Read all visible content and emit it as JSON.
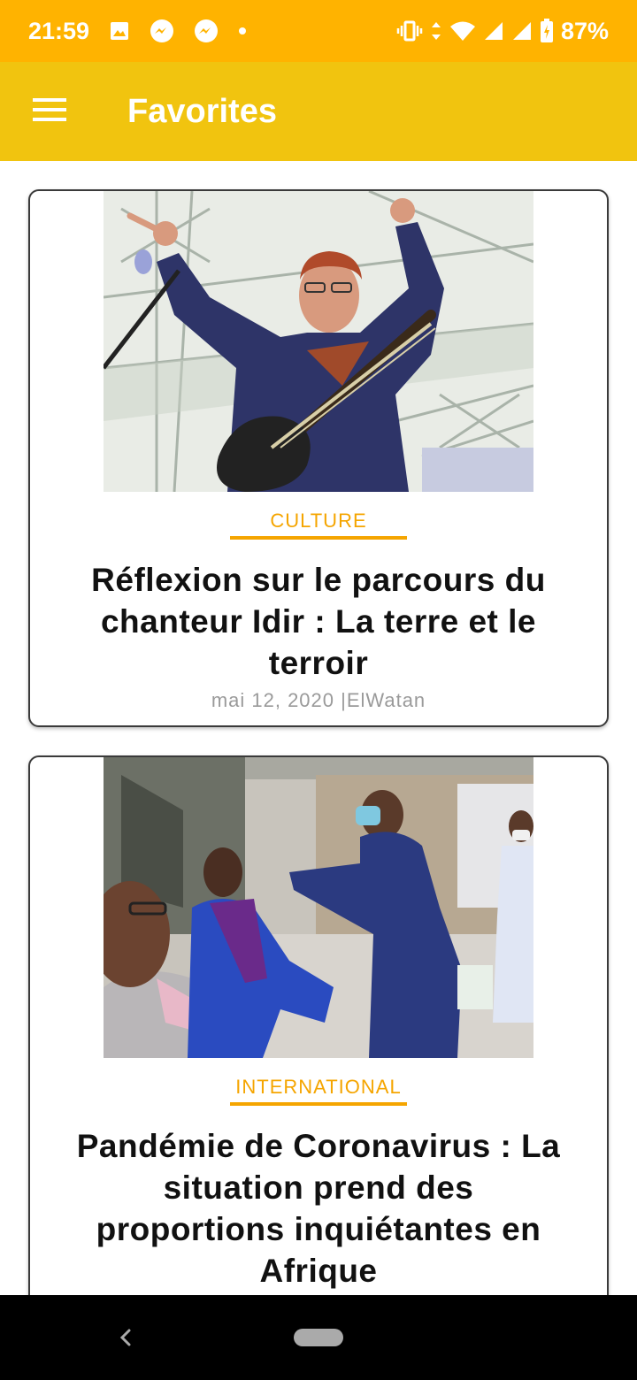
{
  "status_bar": {
    "time": "21:59",
    "battery": "87%",
    "notification_icons": [
      "gallery-icon",
      "messenger-icon",
      "messenger-icon",
      "dot-icon"
    ],
    "system_icons": [
      "vibrate-icon",
      "data-arrows-icon",
      "wifi-icon",
      "signal-icon",
      "signal-icon",
      "battery-charging-icon"
    ]
  },
  "app_bar": {
    "title": "Favorites",
    "menu_icon": "hamburger-menu-icon"
  },
  "articles": [
    {
      "category": "CULTURE",
      "title": "Réflexion sur le parcours du chanteur Idir : La terre et le terroir",
      "meta": "mai 12, 2020 |ElWatan"
    },
    {
      "category": "INTERNATIONAL",
      "title": "Pandémie de Coronavirus : La situation prend des proportions inquiétantes en Afrique",
      "meta": ""
    }
  ],
  "colors": {
    "status_bar": "#FFB300",
    "app_bar": "#F1C40F",
    "category_accent": "#F5A500"
  },
  "nav_bar": {
    "back_icon": "back-chevron-icon",
    "home_icon": "home-pill-icon"
  }
}
